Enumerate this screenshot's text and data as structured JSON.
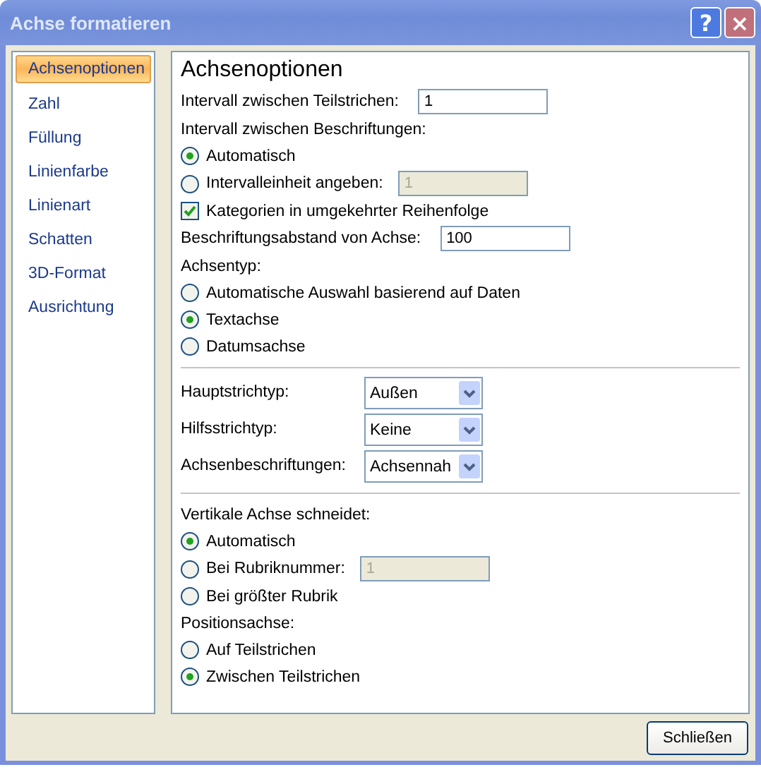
{
  "window": {
    "title": "Achse formatieren",
    "buttons": [
      "?",
      "×"
    ]
  },
  "sidebar": {
    "items": [
      {
        "label": "Achsenoptionen",
        "selected": true
      },
      {
        "label": "Zahl",
        "selected": false
      },
      {
        "label": "Füllung",
        "selected": false
      },
      {
        "label": "Linienfarbe",
        "selected": false
      },
      {
        "label": "Linienart",
        "selected": false
      },
      {
        "label": "Schatten",
        "selected": false
      },
      {
        "label": "3D-Format",
        "selected": false
      },
      {
        "label": "Ausrichtung",
        "selected": false
      }
    ]
  },
  "panel": {
    "title": "Achsenoptionen",
    "rows": [
      {
        "kind": "field",
        "label": "Intervall zwischen Teilstrichen:",
        "value": "1",
        "disabled": false
      },
      {
        "kind": "label",
        "label": "Intervall zwischen Beschriftungen:"
      },
      {
        "kind": "radio",
        "label": "Automatisch",
        "selected": true
      },
      {
        "kind": "radio",
        "label": "Intervalleinheit angeben:",
        "selected": false,
        "value": "1",
        "disabled": true
      },
      {
        "kind": "checkbox",
        "label": "Kategorien in umgekehrter Reihenfolge",
        "checked": true
      },
      {
        "kind": "field",
        "label": "Beschriftungsabstand von Achse:",
        "value": "100",
        "disabled": false
      },
      {
        "kind": "label",
        "label": "Achsentyp:"
      },
      {
        "kind": "radio",
        "label": "Automatische Auswahl basierend auf Daten",
        "selected": false
      },
      {
        "kind": "radio",
        "label": "Textachse",
        "selected": true
      },
      {
        "kind": "radio",
        "label": "Datumsachse",
        "selected": false
      },
      {
        "kind": "divider"
      },
      {
        "kind": "select",
        "label": "Hauptstrichtyp:",
        "value": "Außen"
      },
      {
        "kind": "select",
        "label": "Hilfsstrichtyp:",
        "value": "Keine"
      },
      {
        "kind": "select",
        "label": "Achsenbeschriftungen:",
        "value": "Achsennah"
      },
      {
        "kind": "divider"
      },
      {
        "kind": "label",
        "label": "Vertikale Achse schneidet:"
      },
      {
        "kind": "radio",
        "label": "Automatisch",
        "selected": true
      },
      {
        "kind": "radio",
        "label": "Bei Rubriknummer:",
        "selected": false,
        "value": "1",
        "disabled": true
      },
      {
        "kind": "radio",
        "label": "Bei größter Rubrik",
        "selected": false
      },
      {
        "kind": "label",
        "label": "Positionsachse:"
      },
      {
        "kind": "radio",
        "label": "Auf Teilstrichen",
        "selected": false
      },
      {
        "kind": "radio",
        "label": "Zwischen Teilstrichen",
        "selected": true
      }
    ]
  },
  "footer": {
    "button": "Schließen"
  }
}
